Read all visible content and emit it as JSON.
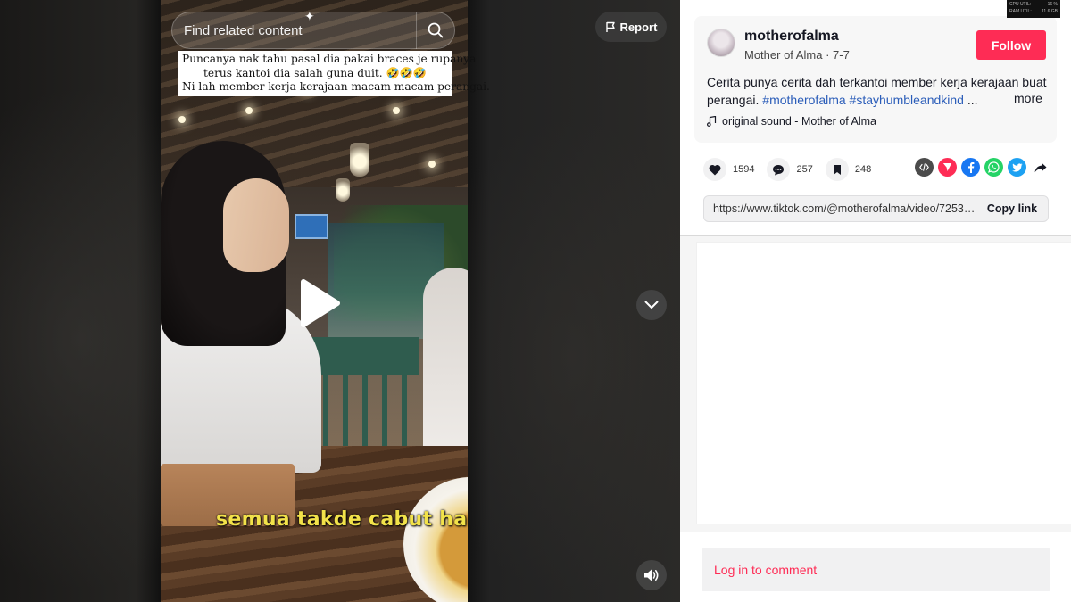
{
  "search": {
    "placeholder": "Find related content"
  },
  "report": {
    "label": "Report"
  },
  "video_overlay": {
    "lines": [
      "Puncanya nak tahu pasal dia pakai braces je rupanya",
      "terus kantoi dia salah guna duit. 🤣🤣🤣",
      "Ni lah member kerja kerajaan macam macam perangai."
    ],
    "subtitle": "semua takde cabut ha"
  },
  "post": {
    "username": "motherofalma",
    "display_name": "Mother of Alma",
    "date": "7-7",
    "follow_label": "Follow",
    "description_text": "Cerita punya cerita dah terkantoi member kerja kerajaan buat perangai. ",
    "hashtags": "#motherofalma #stayhumbleandkind",
    "ellipsis": " ...",
    "more_label": "more",
    "sound": "original sound - Mother of Alma"
  },
  "actions": {
    "likes": "1594",
    "comments": "257",
    "saves": "248"
  },
  "share": {
    "icons": [
      "embed-icon",
      "send-icon",
      "facebook-icon",
      "whatsapp-icon",
      "twitter-icon",
      "share-arrow-icon"
    ],
    "colors": {
      "embed": "#4b4b4b",
      "send": "#fe2c55",
      "facebook": "#1877f2",
      "whatsapp": "#25d366",
      "twitter": "#1da1f2"
    }
  },
  "link": {
    "url": "https://www.tiktok.com/@motherofalma/video/72530...",
    "copy_label": "Copy link"
  },
  "comment": {
    "login_label": "Log in to comment"
  },
  "stats_widget": {
    "rows": [
      [
        "CPU UTIL:",
        "16 %"
      ],
      [
        "RAM UTIL:",
        "11.6 GB"
      ]
    ]
  },
  "colors": {
    "accent": "#fe2c55",
    "hashtag": "#2b5db9"
  }
}
